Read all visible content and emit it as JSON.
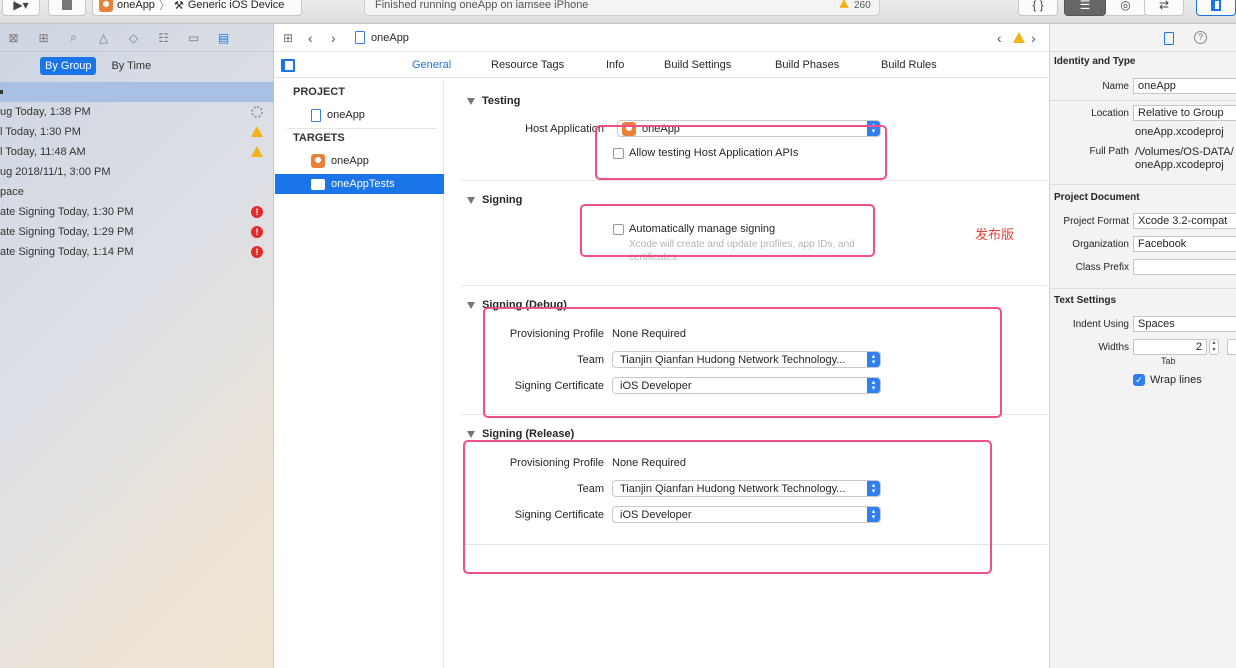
{
  "toolbar": {
    "scheme_app": "oneApp",
    "scheme_separator": "〉",
    "scheme_device": "Generic iOS Device",
    "activity_text": "Finished running oneApp on iamsee iPhone",
    "warning_count": "260",
    "code_button": "{ }"
  },
  "navigator": {
    "segments": [
      "By Group",
      "By Time"
    ],
    "reports": [
      {
        "text": "ug  Today, 1:38 PM",
        "status": "spinner"
      },
      {
        "text": "l  Today, 1:30 PM",
        "status": "warning"
      },
      {
        "text": "l  Today, 11:48 AM",
        "status": "warning"
      },
      {
        "text": "ug  2018/11/1, 3:00 PM",
        "status": ""
      },
      {
        "text": "pace",
        "status": ""
      },
      {
        "text": "ate Signing  Today, 1:30 PM",
        "status": "error"
      },
      {
        "text": "ate Signing  Today, 1:29 PM",
        "status": "error"
      },
      {
        "text": "ate Signing  Today, 1:14 PM",
        "status": "error"
      }
    ]
  },
  "editor": {
    "jump_file": "oneApp",
    "tabs": [
      "General",
      "Resource Tags",
      "Info",
      "Build Settings",
      "Build Phases",
      "Build Rules"
    ],
    "outline": {
      "project_header": "PROJECT",
      "project_item": "oneApp",
      "targets_header": "TARGETS",
      "targets": [
        "oneApp",
        "oneAppTests"
      ]
    },
    "testing": {
      "title": "Testing",
      "host_label": "Host Application",
      "host_value": "oneApp",
      "allow_label": "Allow testing Host Application APIs"
    },
    "signing": {
      "title": "Signing",
      "auto_label": "Automatically manage signing",
      "auto_hint_1": "Xcode will create and update profiles, app IDs, and",
      "auto_hint_2": "certificates."
    },
    "annotation": "发布版",
    "signing_debug": {
      "title": "Signing (Debug)",
      "profile_label": "Provisioning Profile",
      "profile_value": "None Required",
      "team_label": "Team",
      "team_value": "Tianjin Qianfan Hudong Network Technology...",
      "cert_label": "Signing Certificate",
      "cert_value": "iOS Developer"
    },
    "signing_release": {
      "title": "Signing (Release)",
      "profile_label": "Provisioning Profile",
      "profile_value": "None Required",
      "team_label": "Team",
      "team_value": "Tianjin Qianfan Hudong Network Technology...",
      "cert_label": "Signing Certificate",
      "cert_value": "iOS Developer"
    }
  },
  "inspector": {
    "identity_title": "Identity and Type",
    "name_label": "Name",
    "name_value": "oneApp",
    "location_label": "Location",
    "location_value": "Relative to Group",
    "location_file": "oneApp.xcodeproj",
    "fullpath_label": "Full Path",
    "fullpath_value_1": "/Volumes/OS-DATA/",
    "fullpath_value_2": "oneApp.xcodeproj",
    "project_doc_title": "Project Document",
    "format_label": "Project Format",
    "format_value": "Xcode 3.2-compat",
    "org_label": "Organization",
    "org_value": "Facebook",
    "prefix_label": "Class Prefix",
    "prefix_value": "",
    "text_settings_title": "Text Settings",
    "indent_label": "Indent Using",
    "indent_value": "Spaces",
    "widths_label": "Widths",
    "widths_value": "2",
    "tab_label": "Tab",
    "wrap_label": "Wrap lines"
  }
}
